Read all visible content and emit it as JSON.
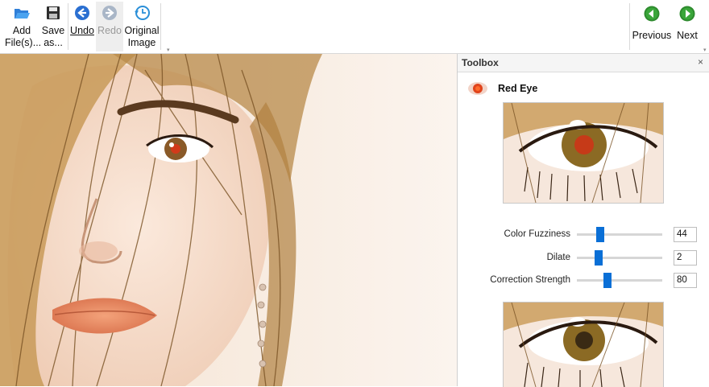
{
  "toolbar": {
    "add_files": "Add\nFile(s)...",
    "save_as": "Save\nas...",
    "undo": "Undo",
    "redo": "Redo",
    "original_image": "Original\nImage",
    "previous": "Previous",
    "next": "Next"
  },
  "toolbox": {
    "title": "Toolbox",
    "close": "×",
    "tool_title": "Red Eye",
    "sliders": [
      {
        "label": "Color Fuzziness",
        "value": "44",
        "fraction": 0.25
      },
      {
        "label": "Dilate",
        "value": "2",
        "fraction": 0.23
      },
      {
        "label": "Correction Strength",
        "value": "80",
        "fraction": 0.34
      }
    ]
  },
  "icons": {
    "add_files": "folder-open-icon",
    "save_as": "floppy-disk-icon",
    "undo": "undo-arrow-icon",
    "redo": "redo-arrow-icon",
    "original_image": "history-clock-icon",
    "previous": "green-left-arrow-icon",
    "next": "green-right-arrow-icon",
    "red_eye": "red-eye-icon"
  },
  "colors": {
    "accent": "#0a6fd6",
    "nav_green": "#2e8b2e",
    "undo_blue": "#2a6fd1"
  }
}
